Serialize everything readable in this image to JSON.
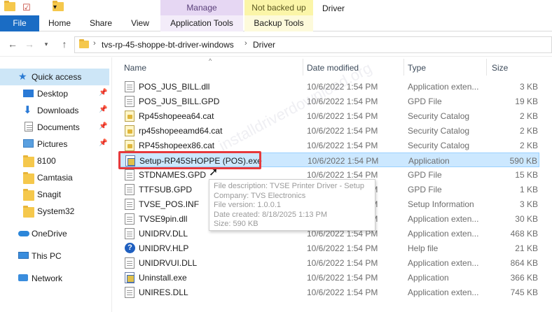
{
  "title_bar": {
    "window_title": "Driver",
    "context_manage": "Manage",
    "context_backup": "Not backed up"
  },
  "ribbon_tabs": {
    "file": "File",
    "home": "Home",
    "share": "Share",
    "view": "View",
    "application_tools": "Application Tools",
    "backup_tools": "Backup Tools"
  },
  "address_bar": {
    "crumbs": [
      "tvs-rp-45-shoppe-bt-driver-windows",
      "Driver"
    ]
  },
  "sidebar": {
    "items": [
      {
        "label": "Quick access",
        "icon": "star-icon",
        "pinned": false
      },
      {
        "label": "Desktop",
        "icon": "desktop-icon",
        "pinned": true
      },
      {
        "label": "Downloads",
        "icon": "download-arrow-icon",
        "pinned": true
      },
      {
        "label": "Documents",
        "icon": "documents-icon",
        "pinned": true
      },
      {
        "label": "Pictures",
        "icon": "pictures-icon",
        "pinned": true
      },
      {
        "label": "8100",
        "icon": "folder-icon",
        "pinned": false
      },
      {
        "label": "Camtasia",
        "icon": "folder-icon",
        "pinned": false
      },
      {
        "label": "Snagit",
        "icon": "folder-icon",
        "pinned": false
      },
      {
        "label": "System32",
        "icon": "folder-icon",
        "pinned": false
      },
      {
        "label": "OneDrive",
        "icon": "cloud-icon",
        "pinned": false
      },
      {
        "label": "This PC",
        "icon": "computer-icon",
        "pinned": false
      },
      {
        "label": "Network",
        "icon": "network-icon",
        "pinned": false
      }
    ]
  },
  "columns": {
    "name": "Name",
    "date_modified": "Date modified",
    "type": "Type",
    "size": "Size"
  },
  "files": [
    {
      "name": "POS_JUS_BILL.dll",
      "date": "10/6/2022 1:54 PM",
      "type": "Application exten...",
      "size": "3 KB",
      "icon": "dll-file-icon"
    },
    {
      "name": "POS_JUS_BILL.GPD",
      "date": "10/6/2022 1:54 PM",
      "type": "GPD File",
      "size": "19 KB",
      "icon": "gpd-file-icon"
    },
    {
      "name": "Rp45shopeea64.cat",
      "date": "10/6/2022 1:54 PM",
      "type": "Security Catalog",
      "size": "2 KB",
      "icon": "catalog-file-icon"
    },
    {
      "name": "rp45shopeeamd64.cat",
      "date": "10/6/2022 1:54 PM",
      "type": "Security Catalog",
      "size": "2 KB",
      "icon": "catalog-file-icon"
    },
    {
      "name": "RP45shopeex86.cat",
      "date": "10/6/2022 1:54 PM",
      "type": "Security Catalog",
      "size": "2 KB",
      "icon": "catalog-file-icon"
    },
    {
      "name": "Setup-RP45SHOPPE (POS).exe",
      "date": "10/6/2022 1:54 PM",
      "type": "Application",
      "size": "590 KB",
      "icon": "exe-file-icon",
      "selected": true
    },
    {
      "name": "STDNAMES.GPD",
      "date": "10/6/2022 1:54 PM",
      "type": "GPD File",
      "size": "15 KB",
      "icon": "gpd-file-icon"
    },
    {
      "name": "TTFSUB.GPD",
      "date": "10/6/2022 1:54 PM",
      "type": "GPD File",
      "size": "1 KB",
      "icon": "gpd-file-icon"
    },
    {
      "name": "TVSE_POS.INF",
      "date": "10/6/2022 1:54 PM",
      "type": "Setup Information",
      "size": "3 KB",
      "icon": "inf-file-icon"
    },
    {
      "name": "TVSE9pin.dll",
      "date": "10/6/2022 1:54 PM",
      "type": "Application exten...",
      "size": "30 KB",
      "icon": "dll-file-icon"
    },
    {
      "name": "UNIDRV.DLL",
      "date": "10/6/2022 1:54 PM",
      "type": "Application exten...",
      "size": "468 KB",
      "icon": "dll-file-icon"
    },
    {
      "name": "UNIDRV.HLP",
      "date": "10/6/2022 1:54 PM",
      "type": "Help file",
      "size": "21 KB",
      "icon": "help-file-icon"
    },
    {
      "name": "UNIDRVUI.DLL",
      "date": "10/6/2022 1:54 PM",
      "type": "Application exten...",
      "size": "864 KB",
      "icon": "dll-file-icon"
    },
    {
      "name": "Uninstall.exe",
      "date": "10/6/2022 1:54 PM",
      "type": "Application",
      "size": "366 KB",
      "icon": "exe-file-icon"
    },
    {
      "name": "UNIRES.DLL",
      "date": "10/6/2022 1:54 PM",
      "type": "Application exten...",
      "size": "745 KB",
      "icon": "dll-file-icon"
    }
  ],
  "tooltip": {
    "lines": [
      "File description: TVSE Printer Driver - Setup",
      "Company: TVS Electronics",
      "File version: 1.0.0.1",
      "Date created: 8/18/2025 1:13 PM",
      "Size: 590 KB"
    ]
  },
  "watermark": "installdriverdownload.org",
  "colors": {
    "file_tab": "#1a6cc4",
    "selection": "#cce8ff",
    "highlight": "#e6393c",
    "manage_context": "#e6d7f3",
    "backup_context": "#fbf5a8"
  }
}
